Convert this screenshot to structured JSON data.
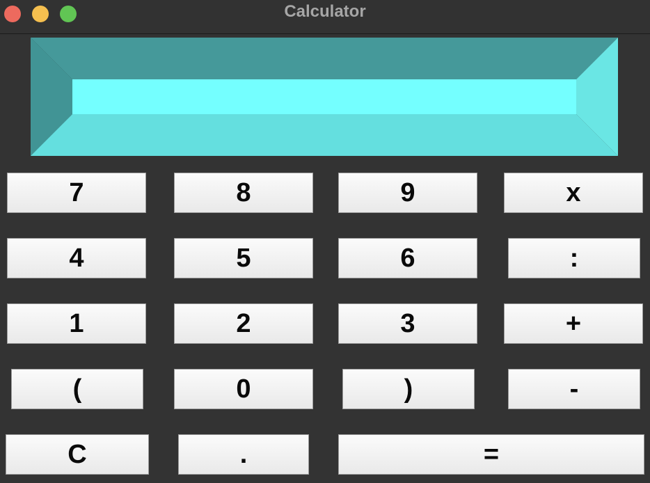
{
  "window": {
    "title": "Calculator"
  },
  "display": {
    "value": ""
  },
  "keys": {
    "seven": "7",
    "eight": "8",
    "nine": "9",
    "multiply": "x",
    "four": "4",
    "five": "5",
    "six": "6",
    "divide": ":",
    "one": "1",
    "two": "2",
    "three": "3",
    "plus": "+",
    "open_paren": "(",
    "zero": "0",
    "close_paren": ")",
    "minus": "-",
    "clear": "C",
    "decimal": ".",
    "equals": "="
  },
  "colors": {
    "window_bg": "#333333",
    "display_top": "#45999a",
    "display_left": "#419495",
    "display_right": "#6ae6e4",
    "display_bottom": "#64dfdf",
    "display_face": "#74ffff"
  }
}
